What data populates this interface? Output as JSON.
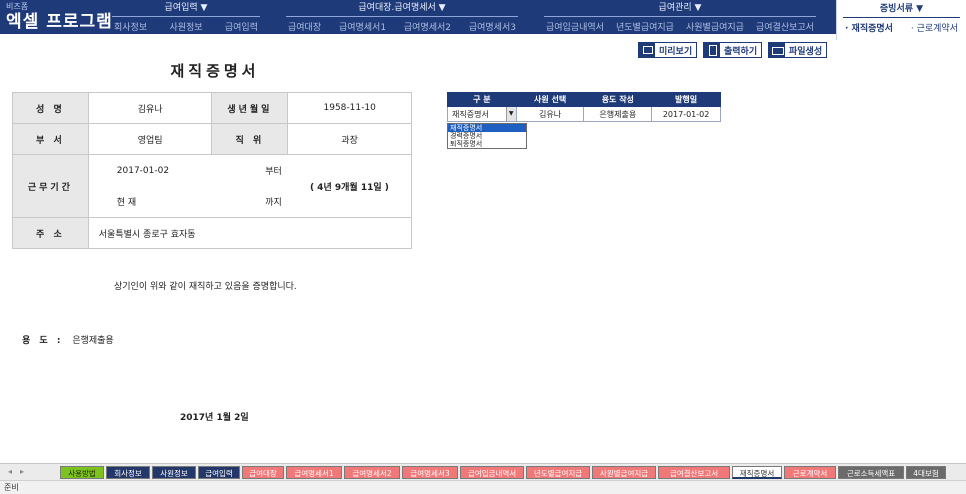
{
  "brand": {
    "small": "비즈폼",
    "big": "엑셀 프로그램"
  },
  "menus": [
    {
      "title": "급여입력 ▼",
      "items": [
        "회사정보",
        "사원정보",
        "급여입력"
      ]
    },
    {
      "title": "급여대장.급여명세서 ▼",
      "items": [
        "급여대장",
        "급여명세서1",
        "급여명세서2",
        "급여명세서3"
      ]
    },
    {
      "title": "급여관리 ▼",
      "items": [
        "급여입금내역서",
        "년도별급여지급",
        "사원별급여지급",
        "급여결산보고서"
      ]
    }
  ],
  "cert_menu": {
    "title": "증빙서류 ▼",
    "items": [
      "· 재직증명서",
      "· 근로계약서"
    ]
  },
  "actions": {
    "preview": "미리보기",
    "print": "출력하기",
    "file": "파일생성"
  },
  "document": {
    "title": "재직증명서",
    "name_label": "성 명",
    "name_value": "김유나",
    "birth_label": "생년월일",
    "birth_value": "1958-11-10",
    "dept_label": "부 서",
    "dept_value": "영업팀",
    "position_label": "직 위",
    "position_value": "과장",
    "period_label": "근무기간",
    "period_start": "2017-01-02",
    "period_start_suffix": "부터",
    "period_end": "현 재",
    "period_end_suffix": "까지",
    "period_total": "( 4년 9개월 11일 )",
    "address_label": "주 소",
    "address_value": "서울특별시 종로구 효자동",
    "statement": "상기인이  위와 같이 재직하고 있음을 증명합니다.",
    "purpose_label": "용 도 :",
    "purpose_value": "은행제출용",
    "issue_date": "2017년 1월 2일"
  },
  "selector": {
    "headers": [
      "구 분",
      "사원 선택",
      "용도 작성",
      "발행일"
    ],
    "values": [
      "재직증명서",
      "김유나",
      "은행제출용",
      "2017-01-02"
    ],
    "dropdown_options": [
      "재직증명서",
      "경력증명서",
      "퇴직증명서"
    ]
  },
  "tabs": [
    {
      "label": "사용방법",
      "style": "green"
    },
    {
      "label": "회사정보",
      "style": "navy"
    },
    {
      "label": "사원정보",
      "style": "navy"
    },
    {
      "label": "급여입력",
      "style": "navy"
    },
    {
      "label": "급여대장",
      "style": "red"
    },
    {
      "label": "급여명세서1",
      "style": "red"
    },
    {
      "label": "급여명세서2",
      "style": "red"
    },
    {
      "label": "급여명세서3",
      "style": "red"
    },
    {
      "label": "급여입금내역서",
      "style": "red"
    },
    {
      "label": "년도별급여지급",
      "style": "red"
    },
    {
      "label": "사원별급여지급",
      "style": "red"
    },
    {
      "label": "급여결산보고서",
      "style": "red"
    },
    {
      "label": "재직증명서",
      "style": "active"
    },
    {
      "label": "근로계약서",
      "style": "red"
    },
    {
      "label": "근로소득세액표",
      "style": "gray"
    },
    {
      "label": "4대보험",
      "style": "gray"
    }
  ],
  "status": "준비"
}
